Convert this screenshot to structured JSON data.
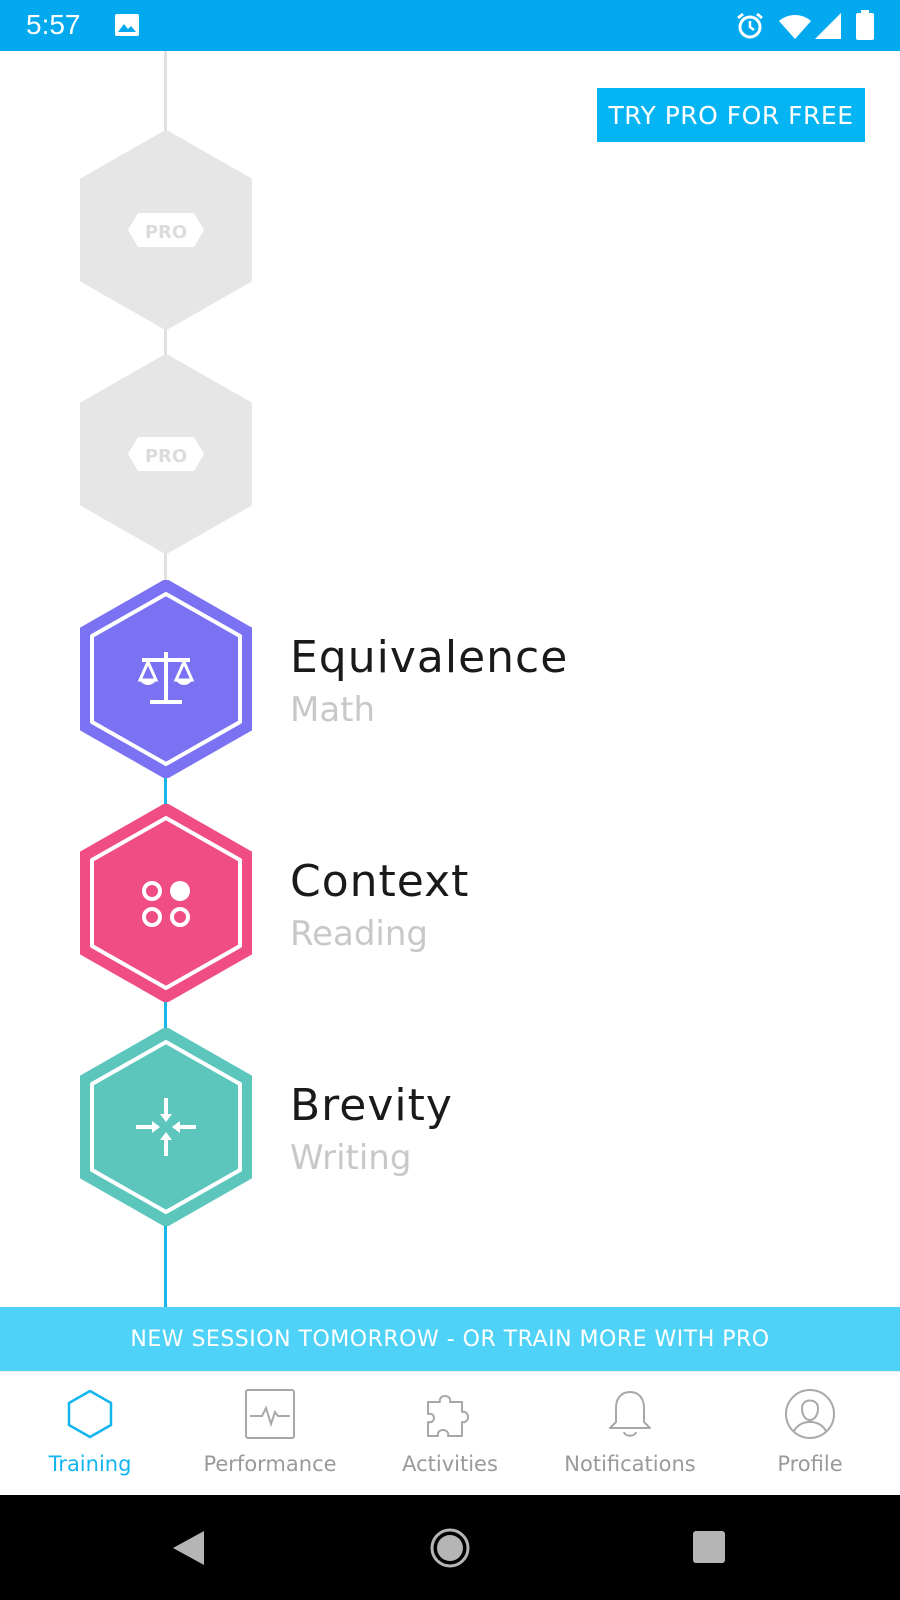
{
  "status_bar": {
    "time": "5:57",
    "icons": [
      "image-icon",
      "alarm-icon",
      "wifi-icon",
      "signal-icon",
      "battery-icon"
    ]
  },
  "header": {
    "try_pro_label": "TRY PRO FOR FREE"
  },
  "locked_items": [
    {
      "badge": "PRO"
    },
    {
      "badge": "PRO"
    }
  ],
  "activities": [
    {
      "title": "Equivalence",
      "subtitle": "Math",
      "color": "#7a72f2",
      "icon": "scales-icon"
    },
    {
      "title": "Context",
      "subtitle": "Reading",
      "color": "#ef4d84",
      "icon": "dots-icon"
    },
    {
      "title": "Brevity",
      "subtitle": "Writing",
      "color": "#5cc6bd",
      "icon": "compress-arrows-icon"
    }
  ],
  "banner": {
    "text": "NEW SESSION TOMORROW - OR TRAIN MORE WITH PRO"
  },
  "bottom_nav": {
    "items": [
      {
        "label": "Training",
        "icon": "hexagon-icon",
        "active": true
      },
      {
        "label": "Performance",
        "icon": "pulse-chart-icon",
        "active": false
      },
      {
        "label": "Activities",
        "icon": "puzzle-icon",
        "active": false
      },
      {
        "label": "Notifications",
        "icon": "bell-icon",
        "active": false
      },
      {
        "label": "Profile",
        "icon": "profile-icon",
        "active": false
      }
    ]
  },
  "colors": {
    "status_bar": "#03a9ef",
    "accent": "#05b4f2",
    "banner": "#4fd2f7",
    "locked": "#e6e6e6"
  }
}
